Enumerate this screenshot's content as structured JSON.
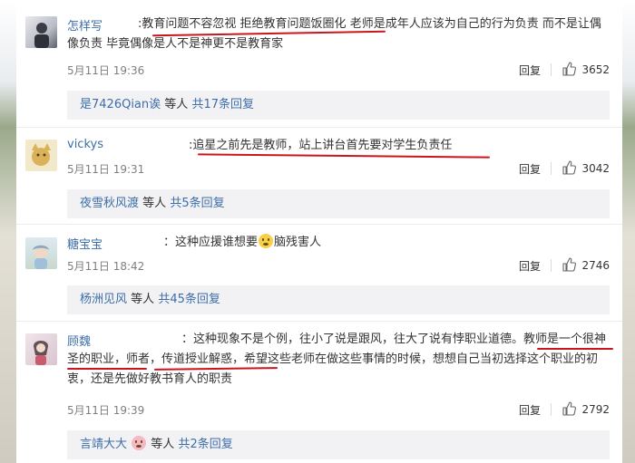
{
  "comments": [
    {
      "username": "怎样写",
      "text_parts": [
        ":",
        "教育问题不容忽视",
        " ",
        "拒绝教育问题饭圈化",
        " 老师是成年人应该为自己的行为负责 而不是让偶像负责 毕竟偶像是人不是神更不是教育家"
      ],
      "date": "5月11日 19:36",
      "reply_label": "回复",
      "likes": "3652",
      "sub_user": "是7426Qian诶",
      "sub_mid": "等人",
      "sub_link": "共17条回复"
    },
    {
      "username": "vickys",
      "text_parts": [
        ":",
        "追星之前先是教师，站上讲台首先要对学生负责任"
      ],
      "date": "5月11日 19:31",
      "reply_label": "回复",
      "likes": "3042",
      "sub_user": "夜雪秋风渡",
      "sub_mid": "等人",
      "sub_link": "共5条回复"
    },
    {
      "username": "糖宝宝",
      "text_parts": [
        "：这种应援谁想要",
        "脑残害人"
      ],
      "date": "5月11日 18:42",
      "reply_label": "回复",
      "likes": "2746",
      "sub_user": "杨洲见风",
      "sub_mid": "等人",
      "sub_link": "共45条回复"
    },
    {
      "username": "顾魏",
      "text_parts": [
        "：这种现象不是个例，往小了说是跟风，往大了说有悖职业道德。",
        "教师是一个",
        "很神圣的职业",
        "，",
        "师者，传道授业解惑",
        "，希望这些老师在做这些事情的时候，想想自己当初选择这个职业的初衷，还是先做好教书育人的职责"
      ],
      "date": "5月11日 19:39",
      "reply_label": "回复",
      "likes": "2792",
      "sub_user": "言靖大大",
      "sub_mid": "等人",
      "sub_link": "共2条回复"
    }
  ],
  "colors": {
    "link": "#3d6ea8",
    "underline": "#c9151e",
    "subbox": "#f2f2f5"
  },
  "icons": [
    "thumbs-up-icon",
    "emoji-icon",
    "avatar"
  ]
}
